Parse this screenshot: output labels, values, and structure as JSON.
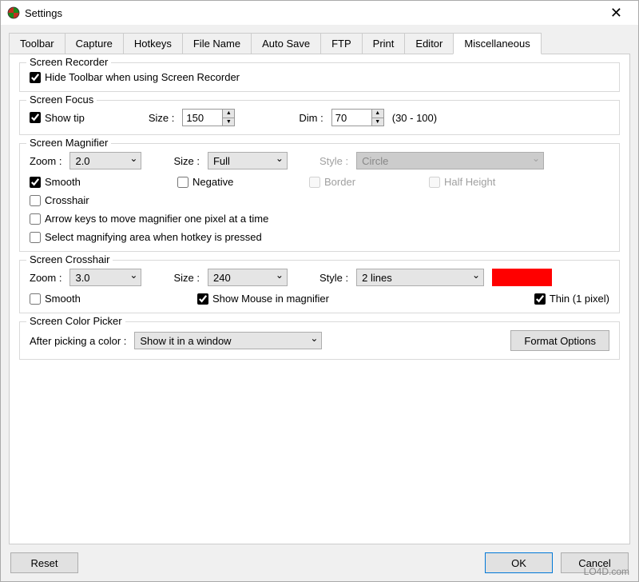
{
  "window": {
    "title": "Settings"
  },
  "tabs": [
    "Toolbar",
    "Capture",
    "Hotkeys",
    "File Name",
    "Auto Save",
    "FTP",
    "Print",
    "Editor",
    "Miscellaneous"
  ],
  "recorder": {
    "legend": "Screen Recorder",
    "hide_toolbar": "Hide Toolbar when using Screen Recorder"
  },
  "focus": {
    "legend": "Screen Focus",
    "show_tip": "Show tip",
    "size_label": "Size :",
    "size_value": "150",
    "dim_label": "Dim :",
    "dim_value": "70",
    "dim_hint": "(30 - 100)"
  },
  "magnifier": {
    "legend": "Screen Magnifier",
    "zoom_label": "Zoom :",
    "zoom_value": "2.0",
    "size_label": "Size :",
    "size_value": "Full",
    "style_label": "Style :",
    "style_value": "Circle",
    "smooth": "Smooth",
    "negative": "Negative",
    "border": "Border",
    "half_height": "Half Height",
    "crosshair": "Crosshair",
    "arrow_keys": "Arrow keys to move magnifier one pixel at a time",
    "select_area": "Select magnifying area when hotkey is pressed"
  },
  "crosshair": {
    "legend": "Screen Crosshair",
    "zoom_label": "Zoom :",
    "zoom_value": "3.0",
    "size_label": "Size :",
    "size_value": "240",
    "style_label": "Style :",
    "style_value": "2 lines",
    "color": "#ff0000",
    "smooth": "Smooth",
    "show_mouse": "Show Mouse in magnifier",
    "thin": "Thin (1 pixel)"
  },
  "picker": {
    "legend": "Screen Color Picker",
    "after_label": "After picking a color :",
    "after_value": "Show it in a window",
    "format_btn": "Format Options"
  },
  "buttons": {
    "reset": "Reset",
    "ok": "OK",
    "cancel": "Cancel"
  },
  "watermark": "LO4D.com"
}
